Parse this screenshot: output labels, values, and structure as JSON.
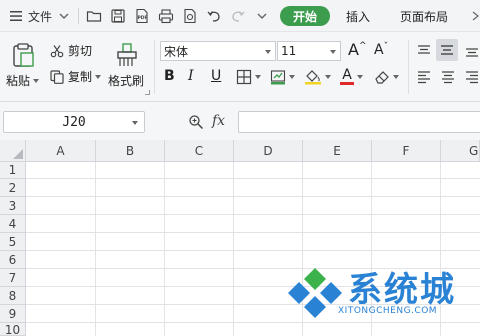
{
  "menubar": {
    "file_label": "文件",
    "tabs": [
      "开始",
      "插入",
      "页面布局"
    ],
    "active_tab": "开始"
  },
  "ribbon": {
    "paste_label": "粘贴",
    "cut_label": "剪切",
    "copy_label": "复制",
    "format_painter_label": "格式刷",
    "font_name": "宋体",
    "font_size": "11",
    "bold": "B",
    "italic": "I",
    "underline": "U",
    "grow_font": "A",
    "shrink_font": "A",
    "font_color_label": "A"
  },
  "formula_bar": {
    "cell_ref": "J20",
    "fx_label": "fx",
    "formula": ""
  },
  "sheet": {
    "columns": [
      "A",
      "B",
      "C",
      "D",
      "E",
      "F",
      "G"
    ],
    "rows": [
      "1",
      "2",
      "3",
      "4",
      "5",
      "6",
      "7",
      "8",
      "9",
      "10"
    ]
  },
  "watermark": {
    "brand": "系统城",
    "url": "XITONGCHENG.COM"
  },
  "colors": {
    "accent": "#3c9d4e",
    "brand_blue": "#2a82d4",
    "brand_green": "#3cb34a"
  }
}
